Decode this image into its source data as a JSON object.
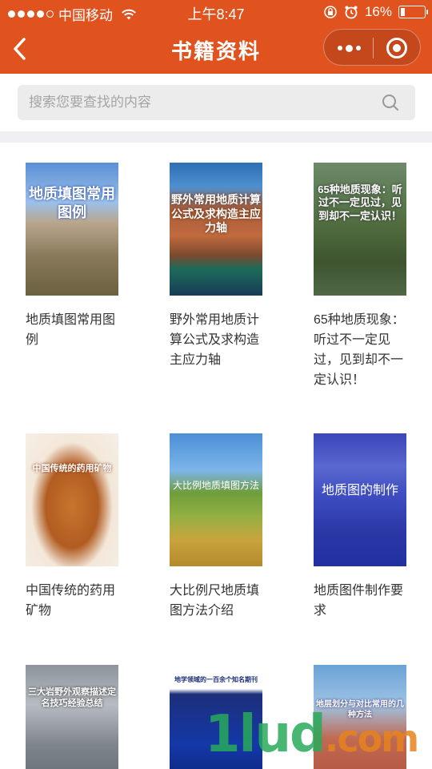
{
  "status_bar": {
    "carrier": "中国移动",
    "time": "上午8:47",
    "battery": "16%"
  },
  "nav": {
    "title": "书籍资料"
  },
  "search": {
    "placeholder": "搜索您要查找的内容",
    "value": ""
  },
  "books": [
    {
      "name": "地质填图常用图例",
      "cover_text": "地质填图常用图例"
    },
    {
      "name": "野外常用地质计算公式及求构造主应力轴",
      "cover_text": "野外常用地质计算公式及求构造主应力轴"
    },
    {
      "name": "65种地质现象：听过不一定见过，见到却不一定认识！",
      "cover_text": "65种地质现象：听过不一定见过，见到却不一定认识！"
    },
    {
      "name": "中国传统的药用矿物",
      "cover_text": "中国传统的药用矿物"
    },
    {
      "name": "大比例尺地质填图方法介绍",
      "cover_text": "大比例地质填图方法"
    },
    {
      "name": "地质图件制作要求",
      "cover_text": "地质图的制作"
    },
    {
      "name": "",
      "cover_text": "三大岩野外观察描述定名技巧经验总结"
    },
    {
      "name": "",
      "cover_text": "地学领域的一百余个知名期刊"
    },
    {
      "name": "",
      "cover_text": "地层划分与对比常用的几种方法"
    }
  ],
  "watermark": {
    "main": "1lud",
    "suffix": ".com"
  }
}
